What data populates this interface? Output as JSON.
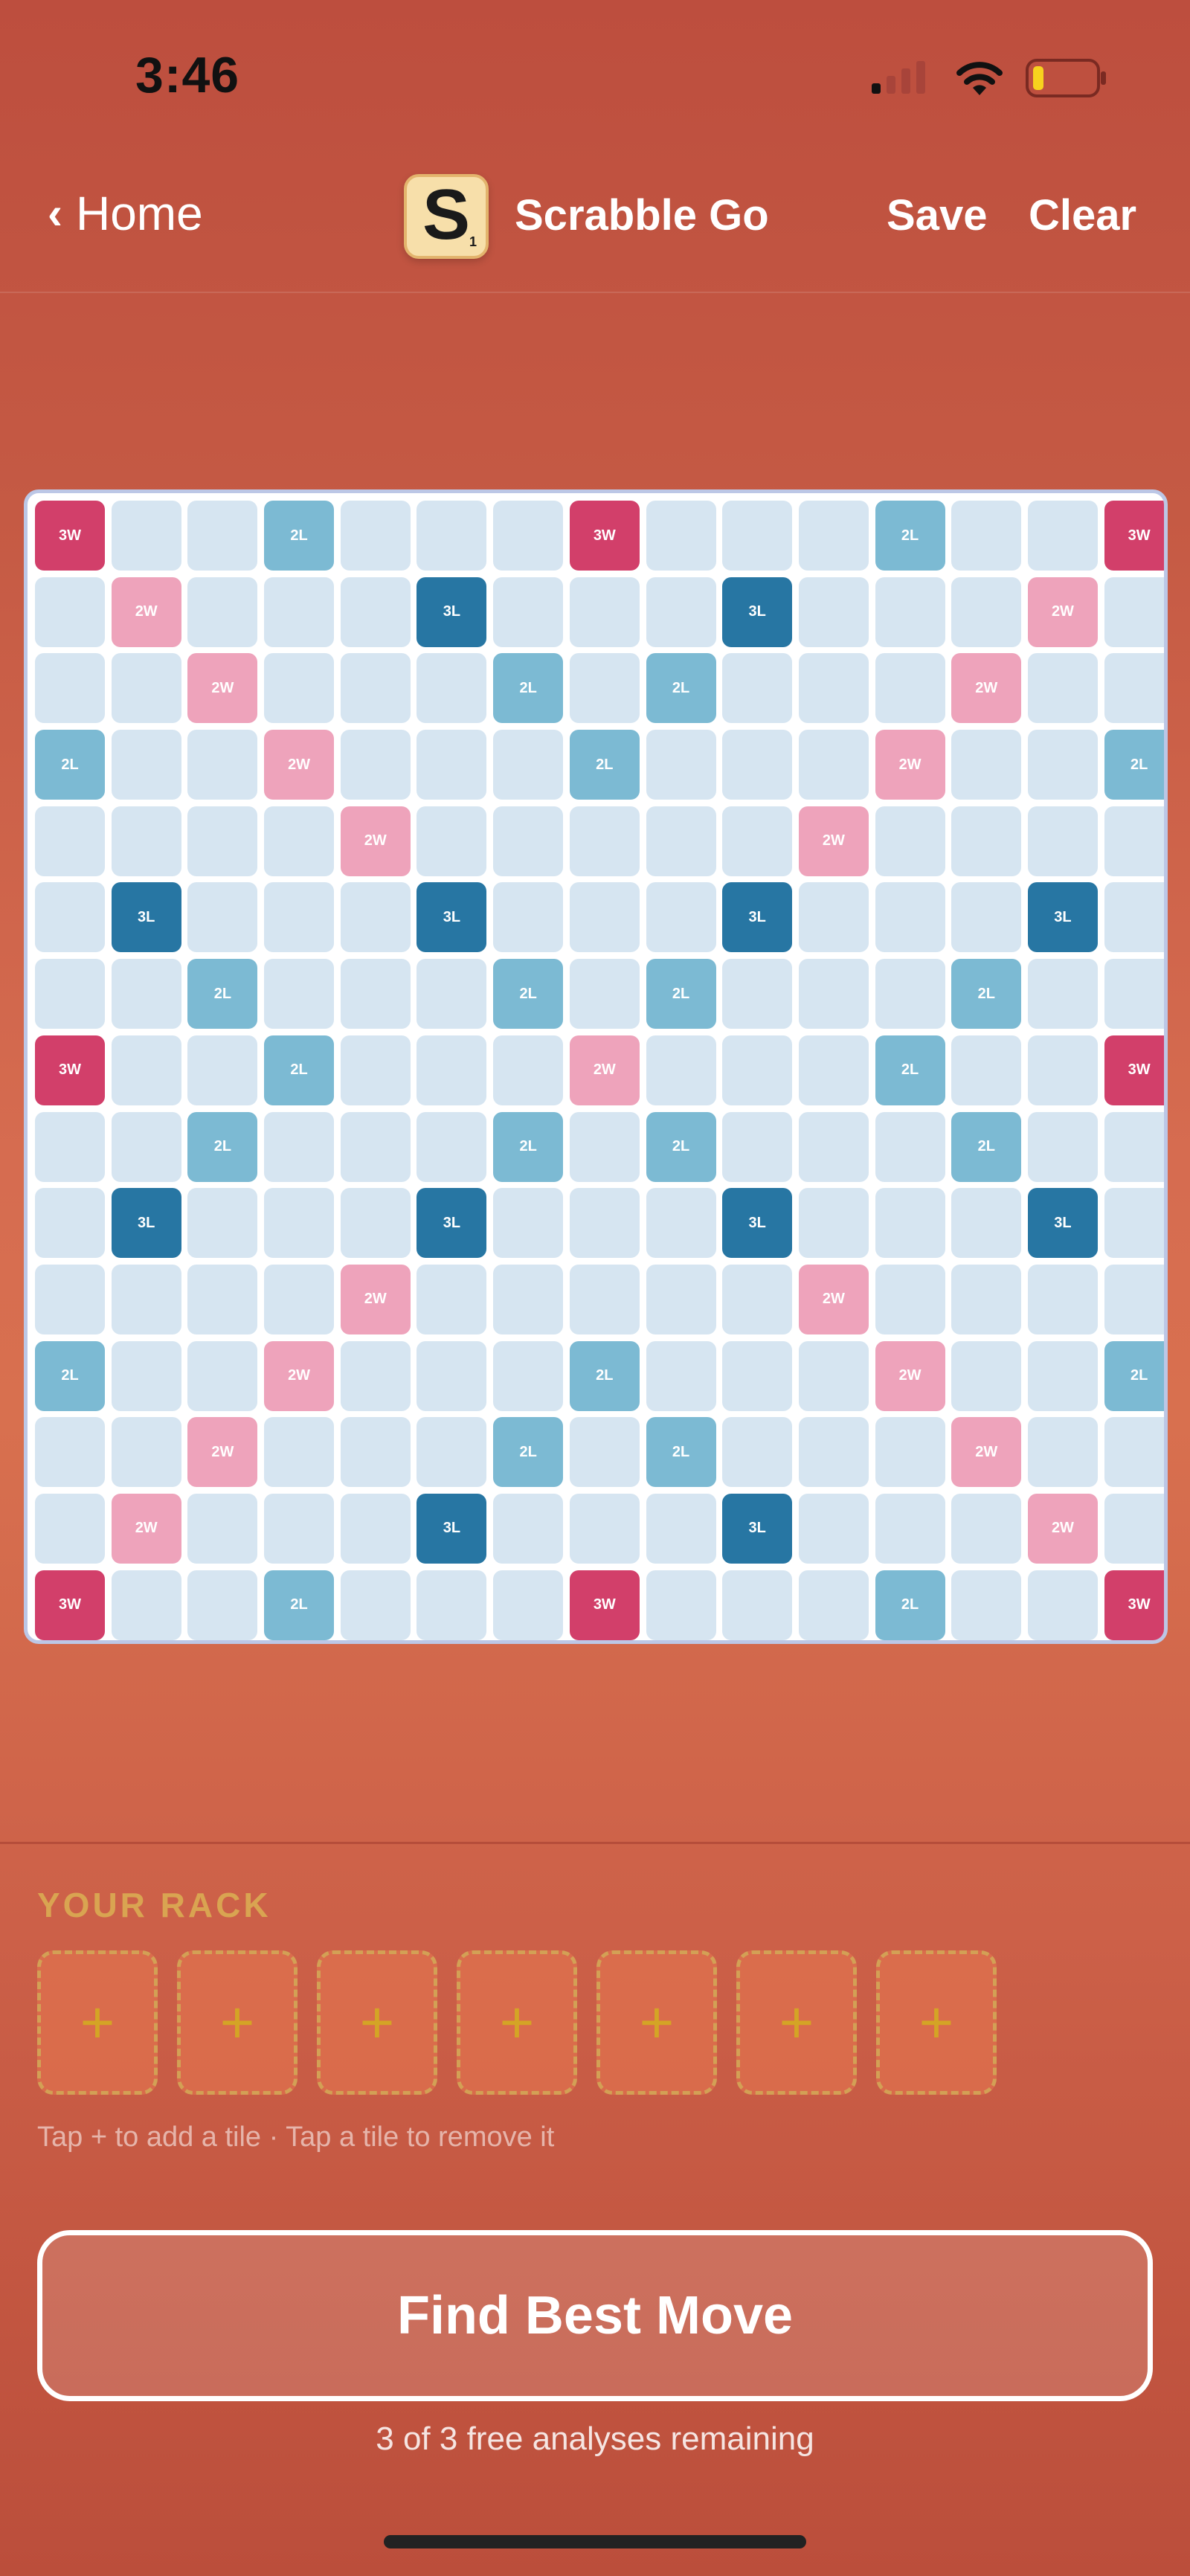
{
  "status_bar": {
    "time": "3:46"
  },
  "nav": {
    "back_label": "Home",
    "logo_letter": "S",
    "logo_points": "1",
    "title": "Scrabble Go",
    "save_label": "Save",
    "clear_label": "Clear"
  },
  "board": {
    "rows": [
      [
        "3W",
        "",
        "",
        "2L",
        "",
        "",
        "",
        "3W",
        "",
        "",
        "",
        "2L",
        "",
        "",
        "3W"
      ],
      [
        "",
        "2W",
        "",
        "",
        "",
        "3L",
        "",
        "",
        "",
        "3L",
        "",
        "",
        "",
        "2W",
        ""
      ],
      [
        "",
        "",
        "2W",
        "",
        "",
        "",
        "2L",
        "",
        "2L",
        "",
        "",
        "",
        "2W",
        "",
        ""
      ],
      [
        "2L",
        "",
        "",
        "2W",
        "",
        "",
        "",
        "2L",
        "",
        "",
        "",
        "2W",
        "",
        "",
        "2L"
      ],
      [
        "",
        "",
        "",
        "",
        "2W",
        "",
        "",
        "",
        "",
        "",
        "2W",
        "",
        "",
        "",
        ""
      ],
      [
        "",
        "3L",
        "",
        "",
        "",
        "3L",
        "",
        "",
        "",
        "3L",
        "",
        "",
        "",
        "3L",
        ""
      ],
      [
        "",
        "",
        "2L",
        "",
        "",
        "",
        "2L",
        "",
        "2L",
        "",
        "",
        "",
        "2L",
        "",
        ""
      ],
      [
        "3W",
        "",
        "",
        "2L",
        "",
        "",
        "",
        "2W",
        "",
        "",
        "",
        "2L",
        "",
        "",
        "3W"
      ],
      [
        "",
        "",
        "2L",
        "",
        "",
        "",
        "2L",
        "",
        "2L",
        "",
        "",
        "",
        "2L",
        "",
        ""
      ],
      [
        "",
        "3L",
        "",
        "",
        "",
        "3L",
        "",
        "",
        "",
        "3L",
        "",
        "",
        "",
        "3L",
        ""
      ],
      [
        "",
        "",
        "",
        "",
        "2W",
        "",
        "",
        "",
        "",
        "",
        "2W",
        "",
        "",
        "",
        ""
      ],
      [
        "2L",
        "",
        "",
        "2W",
        "",
        "",
        "",
        "2L",
        "",
        "",
        "",
        "2W",
        "",
        "",
        "2L"
      ],
      [
        "",
        "",
        "2W",
        "",
        "",
        "",
        "2L",
        "",
        "2L",
        "",
        "",
        "",
        "2W",
        "",
        ""
      ],
      [
        "",
        "2W",
        "",
        "",
        "",
        "3L",
        "",
        "",
        "",
        "3L",
        "",
        "",
        "",
        "2W",
        ""
      ],
      [
        "3W",
        "",
        "",
        "2L",
        "",
        "",
        "",
        "3W",
        "",
        "",
        "",
        "2L",
        "",
        "",
        "3W"
      ]
    ]
  },
  "rack": {
    "title": "YOUR RACK",
    "slots": [
      "+",
      "+",
      "+",
      "+",
      "+",
      "+",
      "+"
    ],
    "hint": "Tap + to add a tile · Tap a tile to remove it"
  },
  "actions": {
    "find_label": "Find Best Move",
    "free_remaining": "3 of 3 free analyses remaining"
  },
  "colors": {
    "triple_word": "#d23f6a",
    "double_word": "#eea3bb",
    "triple_letter": "#2776a3",
    "double_letter": "#7cbad3",
    "empty_cell": "#d6e5f1"
  },
  "icons": {
    "signal": "cellular-signal-icon",
    "wifi": "wifi-icon",
    "battery": "battery-low-icon"
  }
}
